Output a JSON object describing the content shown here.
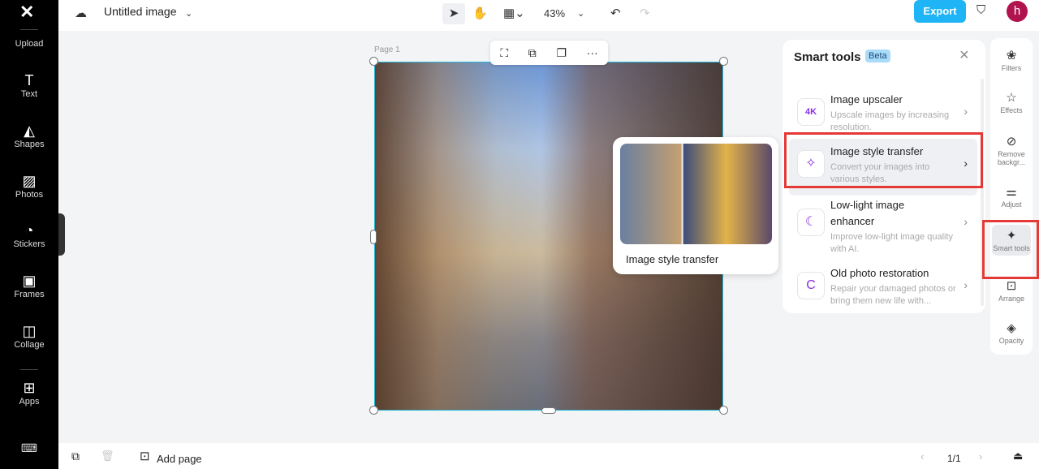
{
  "left_nav": {
    "items": [
      {
        "label": "Upload",
        "icon": "upload-icon",
        "glyph": ""
      },
      {
        "label": "Text",
        "icon": "text-icon",
        "glyph": "T"
      },
      {
        "label": "Shapes",
        "icon": "shapes-icon",
        "glyph": "◭"
      },
      {
        "label": "Photos",
        "icon": "photos-icon",
        "glyph": "▨"
      },
      {
        "label": "Stickers",
        "icon": "stickers-icon",
        "glyph": "◔"
      },
      {
        "label": "Frames",
        "icon": "frames-icon",
        "glyph": "▣"
      },
      {
        "label": "Collage",
        "icon": "collage-icon",
        "glyph": "◫"
      },
      {
        "label": "Apps",
        "icon": "apps-icon",
        "glyph": "⊞"
      }
    ]
  },
  "header": {
    "title": "Untitled image",
    "zoom": "43%",
    "export": "Export",
    "avatar": "h"
  },
  "canvas": {
    "page_label": "Page 1"
  },
  "preview": {
    "caption": "Image style transfer"
  },
  "smart_tools": {
    "title": "Smart tools",
    "badge": "Beta",
    "items": [
      {
        "title": "Image upscaler",
        "desc": "Upscale images by increasing resolution.",
        "glyph": "4K"
      },
      {
        "title": "Image style transfer",
        "desc": "Convert your images into various styles.",
        "glyph": "✧"
      },
      {
        "title": "Low-light image enhancer",
        "desc": "Improve low-light image quality with AI.",
        "glyph": "☾"
      },
      {
        "title": "Old photo restoration",
        "desc": "Repair your damaged photos or bring them new life with...",
        "glyph": "C"
      }
    ]
  },
  "right_nav": {
    "items": [
      {
        "label": "Filters",
        "glyph": "❀"
      },
      {
        "label": "Effects",
        "glyph": "☆"
      },
      {
        "label": "Remove backgr...",
        "glyph": "⊘"
      },
      {
        "label": "Adjust",
        "glyph": "⚌"
      },
      {
        "label": "Smart tools",
        "glyph": "✦"
      },
      {
        "label": "Arrange",
        "glyph": "⊡"
      },
      {
        "label": "Opacity",
        "glyph": "◈"
      }
    ]
  },
  "bottom": {
    "add_page": "Add page",
    "page_count": "1/1"
  },
  "colors": {
    "accent": "#1fb4f5",
    "highlight": "#e53935",
    "tool_icon": "#8b2fe6"
  }
}
